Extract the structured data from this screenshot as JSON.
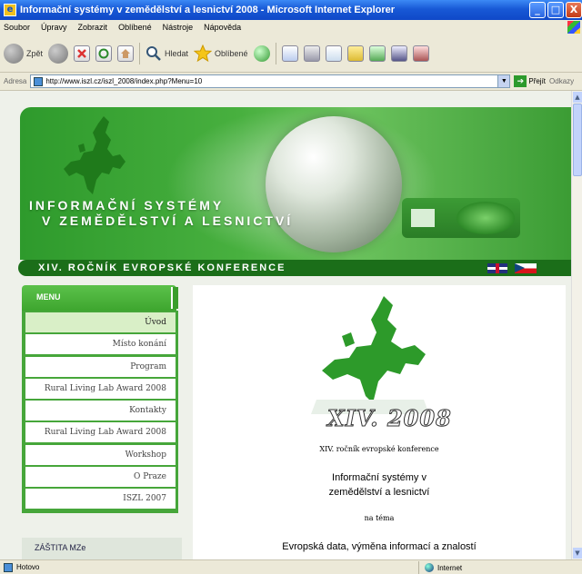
{
  "window": {
    "title": "Informační systémy v zemědělství a lesnictví 2008 - Microsoft Internet Explorer",
    "buttons": {
      "minimize": "_",
      "maximize": "□",
      "close": "X"
    }
  },
  "menubar": {
    "items": [
      "Soubor",
      "Úpravy",
      "Zobrazit",
      "Oblíbené",
      "Nástroje",
      "Nápověda"
    ]
  },
  "toolbar": {
    "back_label": "Zpět",
    "search_label": "Hledat",
    "favorites_label": "Oblíbené"
  },
  "address": {
    "label": "Adresa",
    "url": "http://www.iszl.cz/iszl_2008/index.php?Menu=10",
    "go_label": "Přejít",
    "links_label": "Odkazy"
  },
  "banner": {
    "title_line1": "INFORMAČNÍ SYSTÉMY",
    "title_line2": "V ZEMĚDĚLSTVÍ A LESNICTVÍ"
  },
  "conference_bar": "XIV. ROČNÍK EVROPSKÉ KONFERENCE",
  "menu": {
    "heading": "MENU",
    "items": [
      {
        "label": "Úvod",
        "active": true
      },
      {
        "label": "Místo konání",
        "active": false
      },
      {
        "label": "Program",
        "active": false
      },
      {
        "label": "Rural Living Lab Award 2008",
        "active": false
      },
      {
        "label": "Kontakty",
        "active": false
      },
      {
        "label": "Rural Living Lab Award 2008",
        "active": false
      },
      {
        "label": "Workshop",
        "active": false
      },
      {
        "label": "O Praze",
        "active": false
      },
      {
        "label": "ISZL 2007",
        "active": false
      }
    ],
    "patronage": "ZÁŠTITA MZe"
  },
  "content": {
    "logo_text": "XIV. 2008",
    "subtitle": "XIV. ročník evropské konference",
    "title_line1": "Informační systémy v",
    "title_line2": "zemědělství a lesnictví",
    "on_topic": "na téma",
    "topic": "Evropská data, výměna informací a znalostí"
  },
  "statusbar": {
    "status": "Hotovo",
    "zone": "Internet"
  },
  "colors": {
    "brand_green": "#46a63a",
    "dark_green": "#1b6e19",
    "xp_blue": "#1859d6"
  }
}
